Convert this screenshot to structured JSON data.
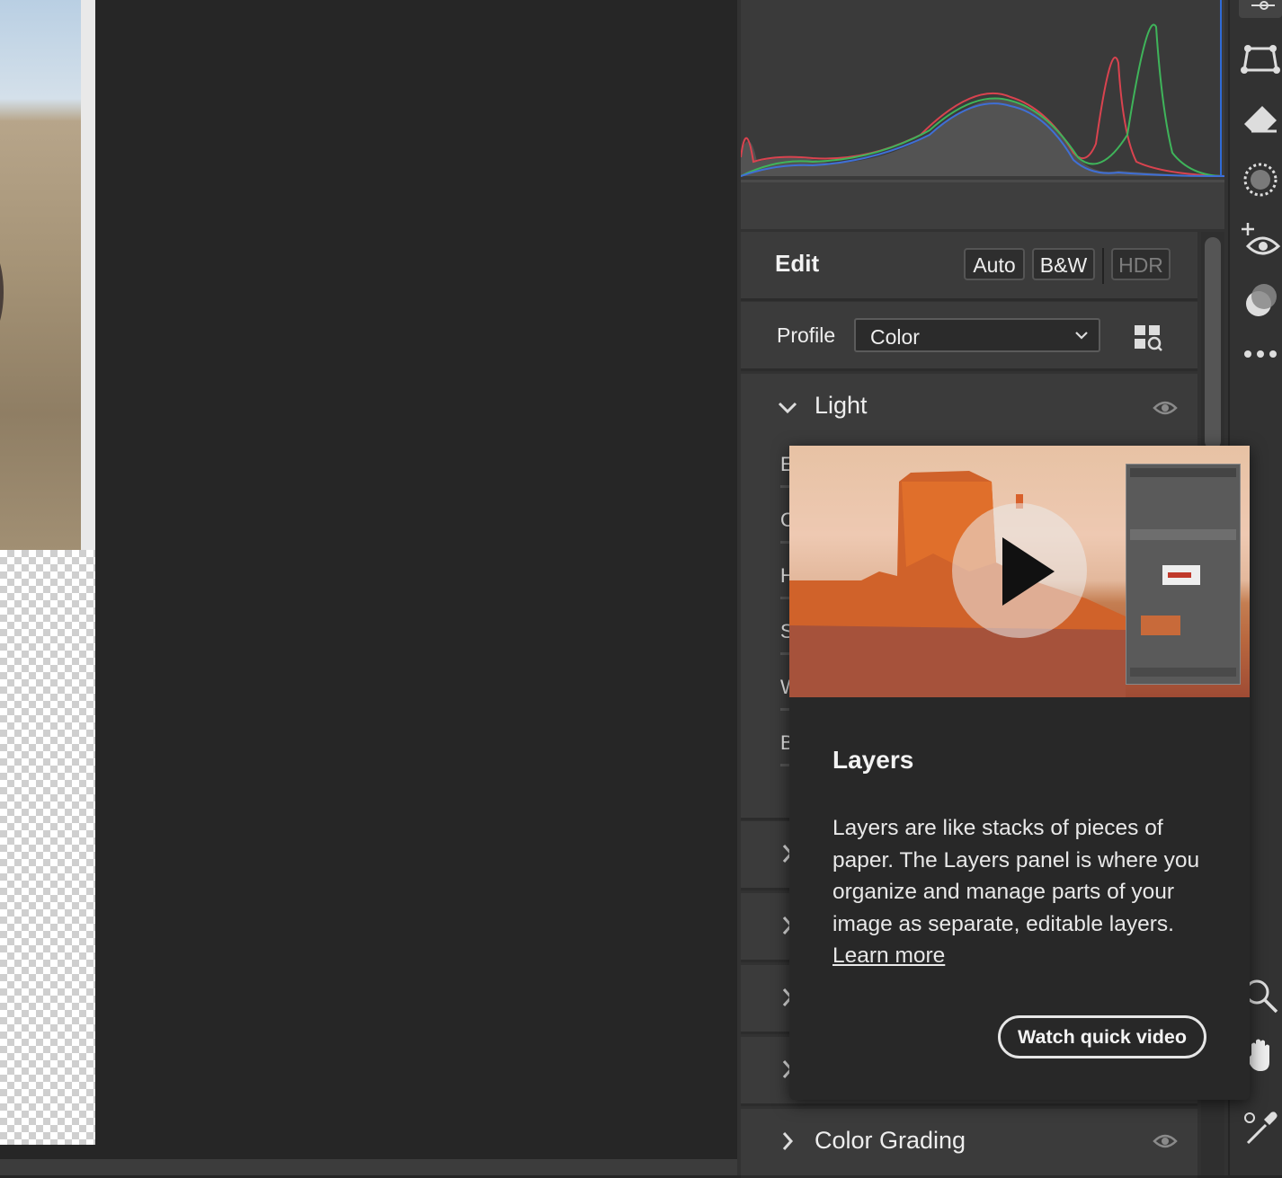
{
  "edit": {
    "title": "Edit",
    "auto_label": "Auto",
    "bw_label": "B&W",
    "hdr_label": "HDR"
  },
  "profile": {
    "label": "Profile",
    "value": "Color"
  },
  "light": {
    "label": "Light",
    "items": [
      "E",
      "C",
      "H",
      "S",
      "W",
      "B"
    ]
  },
  "color_grading": {
    "label": "Color Grading"
  },
  "popup": {
    "title": "Layers",
    "body": "Layers are like stacks of pieces of paper. The Layers panel is where you organize and manage parts of your image as separate, editable layers.",
    "learn_more": "Learn more",
    "button_label": "Watch quick video"
  },
  "toolbar": {
    "icons": [
      "sliders-icon",
      "transform-icon",
      "eraser-icon",
      "mask-icon",
      "red-eye-icon",
      "presets-icon",
      "more-icon",
      "zoom-icon",
      "hand-icon",
      "eyedropper-icon"
    ]
  },
  "colors": {
    "histogram_red": "#d9434f",
    "histogram_green": "#3fb45a",
    "histogram_blue": "#3f6fd6",
    "accent": "#2f6bd6"
  }
}
